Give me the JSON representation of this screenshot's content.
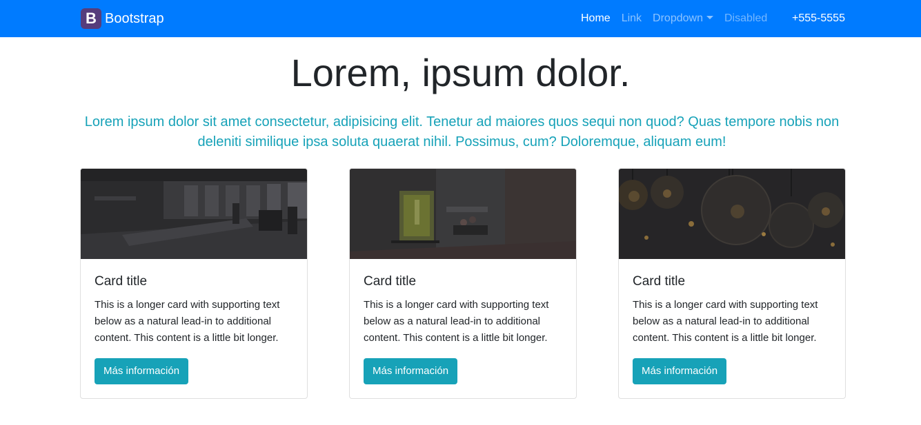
{
  "navbar": {
    "brand_logo": "B",
    "brand": "Bootstrap",
    "items": [
      {
        "label": "Home",
        "state": "active"
      },
      {
        "label": "Link",
        "state": "normal"
      },
      {
        "label": "Dropdown",
        "state": "dropdown"
      },
      {
        "label": "Disabled",
        "state": "disabled"
      }
    ],
    "phone": "+555-5555",
    "colors": {
      "background": "#007bff",
      "brand_logo": "#563d7c"
    }
  },
  "hero": {
    "title": "Lorem, ipsum dolor.",
    "lead": "Lorem ipsum dolor sit amet consectetur, adipisicing elit. Tenetur ad maiores quos sequi non quod? Quas tempore nobis non deleniti similique ipsa soluta quaerat nihil. Possimus, cum? Doloremque, aliquam eum!",
    "lead_color": "#17a2b8"
  },
  "cards": [
    {
      "image": "office-interior-photo",
      "title": "Card title",
      "text": "This is a longer card with supporting text below as a natural lead-in to additional content. This content is a little bit longer.",
      "button": "Más información"
    },
    {
      "image": "coworking-space-photo",
      "title": "Card title",
      "text": "This is a longer card with supporting text below as a natural lead-in to additional content. This content is a little bit longer.",
      "button": "Más información"
    },
    {
      "image": "light-bulbs-photo",
      "title": "Card title",
      "text": "This is a longer card with supporting text below as a natural lead-in to additional content. This content is a little bit longer.",
      "button": "Más información"
    }
  ],
  "button_color": "#17a2b8"
}
